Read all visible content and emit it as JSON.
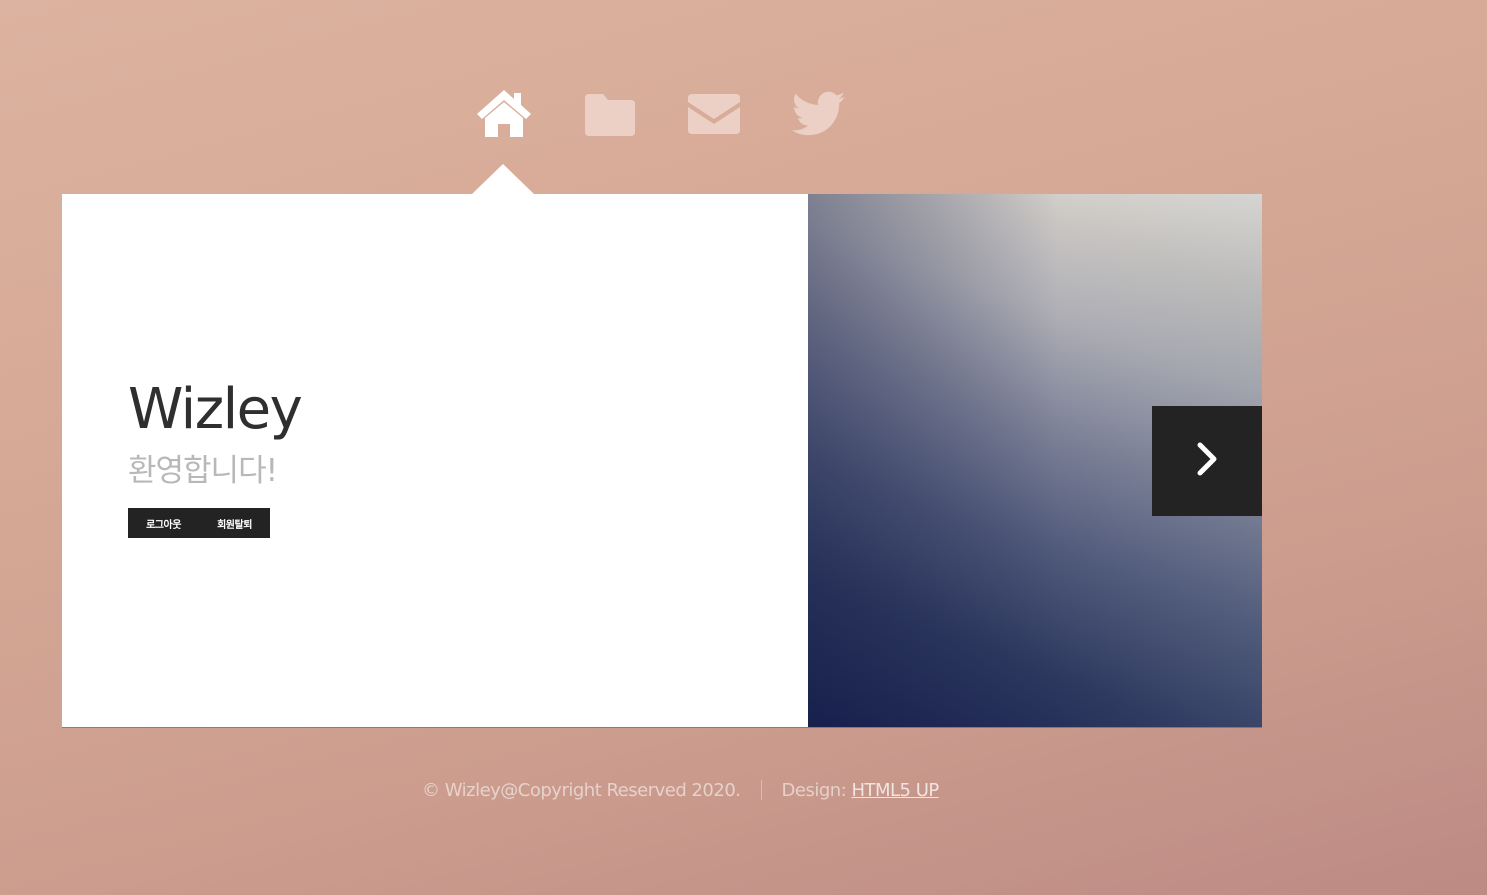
{
  "nav": {
    "items": [
      {
        "icon": "home-icon",
        "label": "Home",
        "active": true
      },
      {
        "icon": "folder-icon",
        "label": "Work",
        "active": false
      },
      {
        "icon": "envelope-icon",
        "label": "Contact",
        "active": false
      },
      {
        "icon": "twitter-icon",
        "label": "Twitter",
        "active": false
      }
    ]
  },
  "intro": {
    "title": "Wizley",
    "subtitle": "환영합니다!",
    "buttons": {
      "logout": "로그아웃",
      "withdraw": "회원탈퇴"
    }
  },
  "hero": {
    "next_icon": "chevron-right-icon"
  },
  "footer": {
    "copyright": "© Wizley@Copyright Reserved 2020.",
    "design_label": "Design: ",
    "design_link": "HTML5 UP"
  },
  "colors": {
    "background": "#d6a996",
    "panel": "#ffffff",
    "dark": "#232323",
    "title": "#2f2f2f",
    "subtitle": "#b8b8b8"
  }
}
